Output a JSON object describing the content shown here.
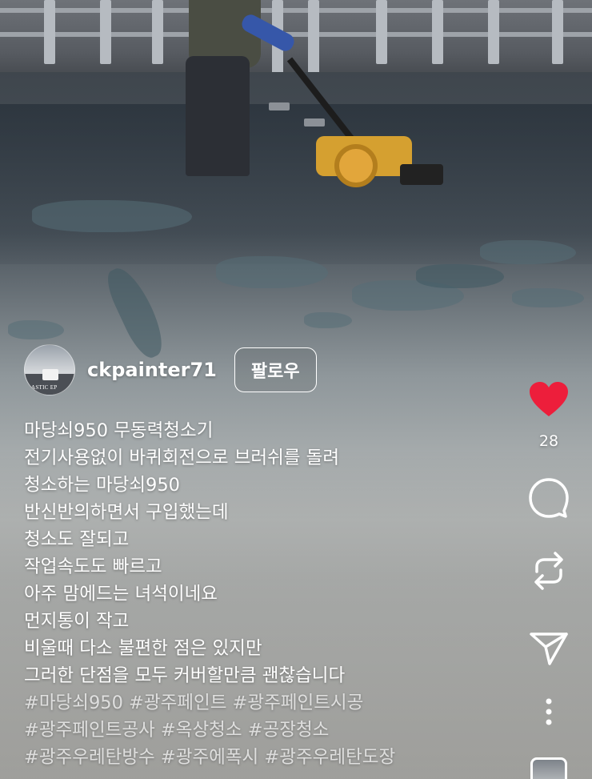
{
  "post": {
    "username": "ckpainter71",
    "follow_label": "팔로우",
    "avatar_text": "ASTIC EP"
  },
  "caption": {
    "lines": [
      "마당쇠950  무동력청소기",
      "전기사용없이 바퀴회전으로 브러쉬를 돌려",
      "청소하는 마당쇠950",
      "반신반의하면서 구입했는데",
      "청소도 잘되고",
      "작업속도도 빠르고",
      "아주 맘에드는 녀석이네요",
      "먼지통이 작고",
      "비울때 다소 불편한 점은 있지만",
      "그러한 단점을 모두 커버할만큼 괜찮습니다"
    ],
    "hashtags": [
      "#마당쇠950 #광주페인트 #광주페인트시공",
      "#광주페인트공사 #옥상청소 #공장청소",
      "#광주우레탄방수 #광주에폭시 #광주우레탄도장"
    ]
  },
  "actions": {
    "like_count": "28",
    "like_color": "#ed1e3b"
  },
  "icons": [
    "heart-icon",
    "comment-icon",
    "repost-icon",
    "share-icon",
    "more-icon",
    "audio-thumbnail"
  ]
}
